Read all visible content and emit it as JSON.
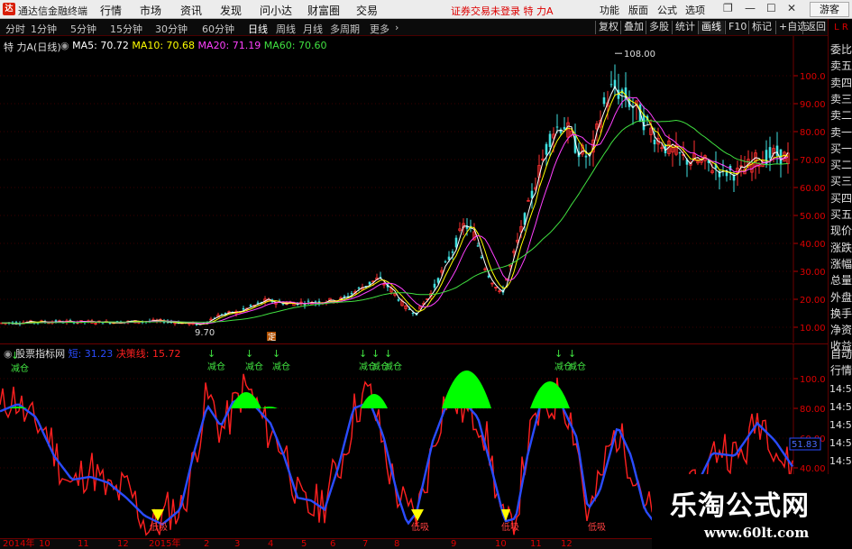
{
  "titlebar": {
    "app_name": "通达信金融终端",
    "menus": [
      "行情",
      "市场",
      "资讯",
      "发现",
      "问小达",
      "财富圈",
      "交易"
    ],
    "notice": "证券交易未登录  特 力A",
    "buttons": [
      "功能",
      "版面",
      "公式",
      "选项"
    ],
    "guest_label": "游客"
  },
  "toolbar": {
    "periods": [
      "分时",
      "1分钟",
      "5分钟",
      "15分钟",
      "30分钟",
      "60分钟",
      "日线",
      "周线",
      "月线",
      "多周期",
      "更多"
    ],
    "active_period": "日线",
    "right_buttons": [
      "复权",
      "叠加",
      "多股",
      "统计",
      "画线",
      "F10",
      "标记",
      "+自选",
      "返回"
    ]
  },
  "main_chart": {
    "stock_label": "特 力A",
    "period_label": "(日线)",
    "ma": [
      {
        "label": "MA5: 70.72",
        "color": "#ffffff"
      },
      {
        "label": "MA10: 70.68",
        "color": "#ffff00"
      },
      {
        "label": "MA20: 71.19",
        "color": "#ff40ff"
      },
      {
        "label": "MA60: 70.60",
        "color": "#40e040"
      }
    ],
    "price_axis": [
      "100.0",
      "90.00",
      "80.00",
      "70.00",
      "60.00",
      "50.00",
      "40.00",
      "30.00",
      "20.00",
      "10.00"
    ],
    "high_label": "108.00",
    "low_label": "9.70",
    "marker_label": "定"
  },
  "indicator": {
    "name": "股票指标网",
    "series": [
      {
        "label": "短: 31.23",
        "color": "#2a4cff"
      },
      {
        "label": "决策线: 15.72",
        "color": "#ff2020"
      }
    ],
    "axis": [
      "100.0",
      "80.00",
      "60.00",
      "40.00"
    ],
    "last_value": "51.83",
    "sell_label": "减仓",
    "buy_label": "低吸",
    "peak_colors": {
      "top": "#00ff00",
      "bottom": "#ffff00"
    }
  },
  "right_panel": {
    "items": [
      "委比",
      "卖五",
      "卖四",
      "卖三",
      "卖二",
      "卖一",
      "买一",
      "买二",
      "买三",
      "买四",
      "买五",
      "现价",
      "涨跌",
      "涨幅",
      "总量",
      "外盘",
      "换手",
      "净资",
      "收益"
    ],
    "tabs": [
      "自动",
      "行情"
    ],
    "times": [
      "14:5",
      "14:5",
      "14:5",
      "14:5",
      "14:5",
      "14:5",
      "14:5",
      "14:5"
    ],
    "header": "L R"
  },
  "date_axis": [
    "2014年",
    "10",
    "11",
    "12",
    "2015年",
    "2",
    "3",
    "4",
    "5",
    "6",
    "7",
    "8",
    "9",
    "10",
    "11",
    "12"
  ],
  "watermark": {
    "title": "乐淘公式网",
    "url": "www.60lt.com"
  }
}
